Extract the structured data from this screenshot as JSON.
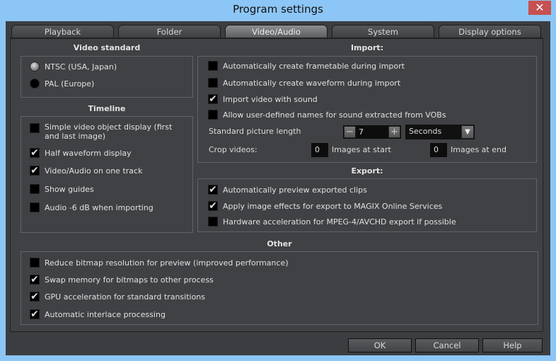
{
  "window": {
    "title": "Program settings",
    "close": "✕"
  },
  "tabs": [
    {
      "label": "Playback"
    },
    {
      "label": "Folder"
    },
    {
      "label": "Video/Audio",
      "active": true
    },
    {
      "label": "System"
    },
    {
      "label": "Display options"
    }
  ],
  "video_standard": {
    "title": "Video standard",
    "options": [
      {
        "label": "NTSC (USA, Japan)",
        "selected": true
      },
      {
        "label": "PAL (Europe)",
        "selected": false
      }
    ]
  },
  "timeline": {
    "title": "Timeline",
    "items": [
      {
        "label": "Simple video object display (first and last image)",
        "checked": false
      },
      {
        "label": "Half waveform display",
        "checked": true
      },
      {
        "label": "Video/Audio on one track",
        "checked": true
      },
      {
        "label": "Show guides",
        "checked": false
      },
      {
        "label": "Audio -6 dB when importing",
        "checked": false
      }
    ]
  },
  "import": {
    "title": "Import:",
    "items": [
      {
        "label": "Automatically create frametable during import",
        "checked": false
      },
      {
        "label": "Automatically create waveform during import",
        "checked": false
      },
      {
        "label": "Import video with sound",
        "checked": true
      },
      {
        "label": "Allow user-defined names for sound extracted from VOBs",
        "checked": false
      }
    ],
    "picture_length_label": "Standard picture length",
    "minus": "−",
    "picture_length": "7",
    "plus": "+",
    "unit": "Seconds",
    "dropdown_arrow": "▼",
    "crop_label": "Crop videos:",
    "crop_start": "0",
    "crop_start_label": "Images at start",
    "crop_end": "0",
    "crop_end_label": "Images at end"
  },
  "export": {
    "title": "Export:",
    "items": [
      {
        "label": "Automatically preview exported clips",
        "checked": true
      },
      {
        "label": "Apply image effects for export to MAGIX Online Services",
        "checked": true
      },
      {
        "label": "Hardware acceleration for MPEG-4/AVCHD export if possible",
        "checked": false
      }
    ]
  },
  "other": {
    "title": "Other",
    "items": [
      {
        "label": "Reduce bitmap resolution for preview (improved performance)",
        "checked": false
      },
      {
        "label": "Swap memory for bitmaps to other process",
        "checked": true
      },
      {
        "label": "GPU acceleration for standard transitions",
        "checked": true
      },
      {
        "label": "Automatic interlace processing",
        "checked": true
      }
    ]
  },
  "buttons": {
    "ok": "OK",
    "cancel": "Cancel",
    "help": "Help"
  },
  "check_glyph": "✔"
}
